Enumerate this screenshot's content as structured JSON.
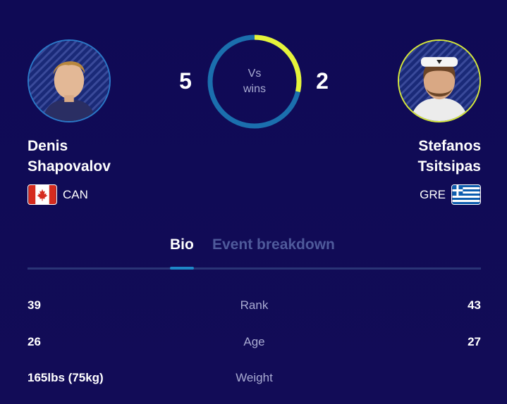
{
  "players": {
    "left": {
      "first_name": "Denis",
      "last_name": "Shapovalov",
      "country": "CAN",
      "flag_icon": "canada-flag-icon"
    },
    "right": {
      "first_name": "Stefanos",
      "last_name": "Tsitsipas",
      "country": "GRE",
      "flag_icon": "greece-flag-icon"
    }
  },
  "h2h": {
    "left_wins": "5",
    "right_wins": "2",
    "label_line1": "Vs",
    "label_line2": "wins",
    "left_share": 0.714,
    "colors": {
      "left": "#1b6fae",
      "right": "#e6f33a"
    }
  },
  "tabs": [
    {
      "label": "Bio",
      "active": true
    },
    {
      "label": "Event breakdown",
      "active": false
    }
  ],
  "stats": [
    {
      "label": "Rank",
      "left": "39",
      "right": "43"
    },
    {
      "label": "Age",
      "left": "26",
      "right": "27"
    },
    {
      "label": "Weight",
      "left": "165lbs (75kg)",
      "right": ""
    }
  ],
  "colors": {
    "background": "#100b52",
    "accent": "#1e87c7",
    "highlight": "#e6f33a"
  }
}
